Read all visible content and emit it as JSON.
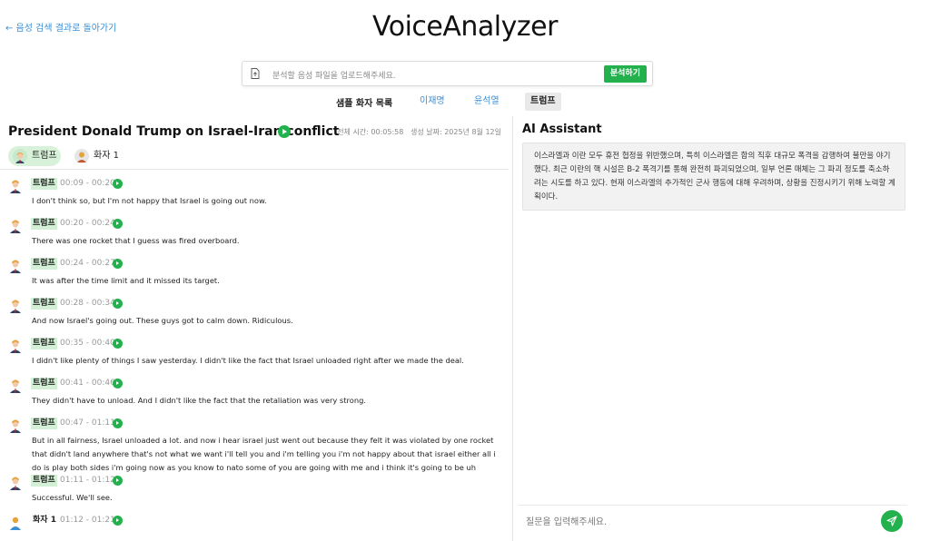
{
  "header": {
    "back_label": "← 음성 검색 결과로 돌아가기",
    "app_title": "VoiceAnalyzer"
  },
  "upload": {
    "placeholder": "분석할 음성 파일을 업로드해주세요.",
    "analyze_label": "분석하기",
    "icon": "file-upload-icon"
  },
  "samples": {
    "label": "샘플 화자 목록",
    "items": [
      {
        "label": "이재명",
        "active": false
      },
      {
        "label": "윤석열",
        "active": false
      },
      {
        "label": "트럼프",
        "active": true
      }
    ]
  },
  "clip": {
    "title": "President Donald Trump on Israel-Iran conflict",
    "duration_label": "전체 시간: 00:05:58",
    "created_label": "생성 날짜: 2025년 8월 12일"
  },
  "speaker_tabs": [
    {
      "label": "트럼프",
      "avatar": "trump-avatar-icon",
      "active": true
    },
    {
      "label": "화자 1",
      "avatar": "person-avatar-icon",
      "active": false
    }
  ],
  "transcript": [
    {
      "speaker": "트럼프",
      "time": "00:09 - 00:20",
      "text": "I don't think so, but I'm not happy that Israel is going out now."
    },
    {
      "speaker": "트럼프",
      "time": "00:20 - 00:24",
      "text": "There was one rocket that I guess was fired overboard."
    },
    {
      "speaker": "트럼프",
      "time": "00:24 - 00:27",
      "text": "It was after the time limit and it missed its target."
    },
    {
      "speaker": "트럼프",
      "time": "00:28 - 00:34",
      "text": "And now Israel's going out. These guys got to calm down. Ridiculous."
    },
    {
      "speaker": "트럼프",
      "time": "00:35 - 00:40",
      "text": "I didn't like plenty of things I saw yesterday. I didn't like the fact that Israel unloaded right after we made the deal."
    },
    {
      "speaker": "트럼프",
      "time": "00:41 - 00:46",
      "text": "They didn't have to unload. And I didn't like the fact that the retaliation was very strong."
    },
    {
      "speaker": "트럼프",
      "time": "00:47 - 01:11",
      "text": "But in all fairness, Israel unloaded a lot. and now i hear israel just went out because they felt it was violated by one rocket that didn't land anywhere that's not what we want i'll tell you and i'm telling you i'm not happy about that israel either all i do is play both sides i'm going now as you know to nato some of you are going with me and i think it's going to be uh"
    },
    {
      "speaker": "트럼프",
      "time": "01:11 - 01:12",
      "text": "Successful. We'll see."
    },
    {
      "speaker": "화자 1",
      "time": "01:12 - 01:21",
      "text": ""
    }
  ],
  "ai": {
    "title": "AI Assistant",
    "summary": "이스라엘과 이란 모두 휴전 협정을 위반했으며, 특히 이스라엘은 합의 직후 대규모 폭격을 감행하여 불만을 야기했다. 최근 이란의 핵 시설은 B-2 폭격기를 통해 완전히 파괴되었으며, 일부 언론 매체는 그 파괴 정도를 축소하려는 시도를 하고 있다. 현재 이스라엘의 추가적인 군사 행동에 대해 우려하며, 상황을 진정시키기 위해 노력할 계획이다.",
    "input_placeholder": "질문을 입력해주세요.",
    "send_icon": "send-icon"
  },
  "colors": {
    "accent_green": "#22b14c",
    "badge_green": "#d3f0d6",
    "link_blue": "#3a8fd6"
  }
}
